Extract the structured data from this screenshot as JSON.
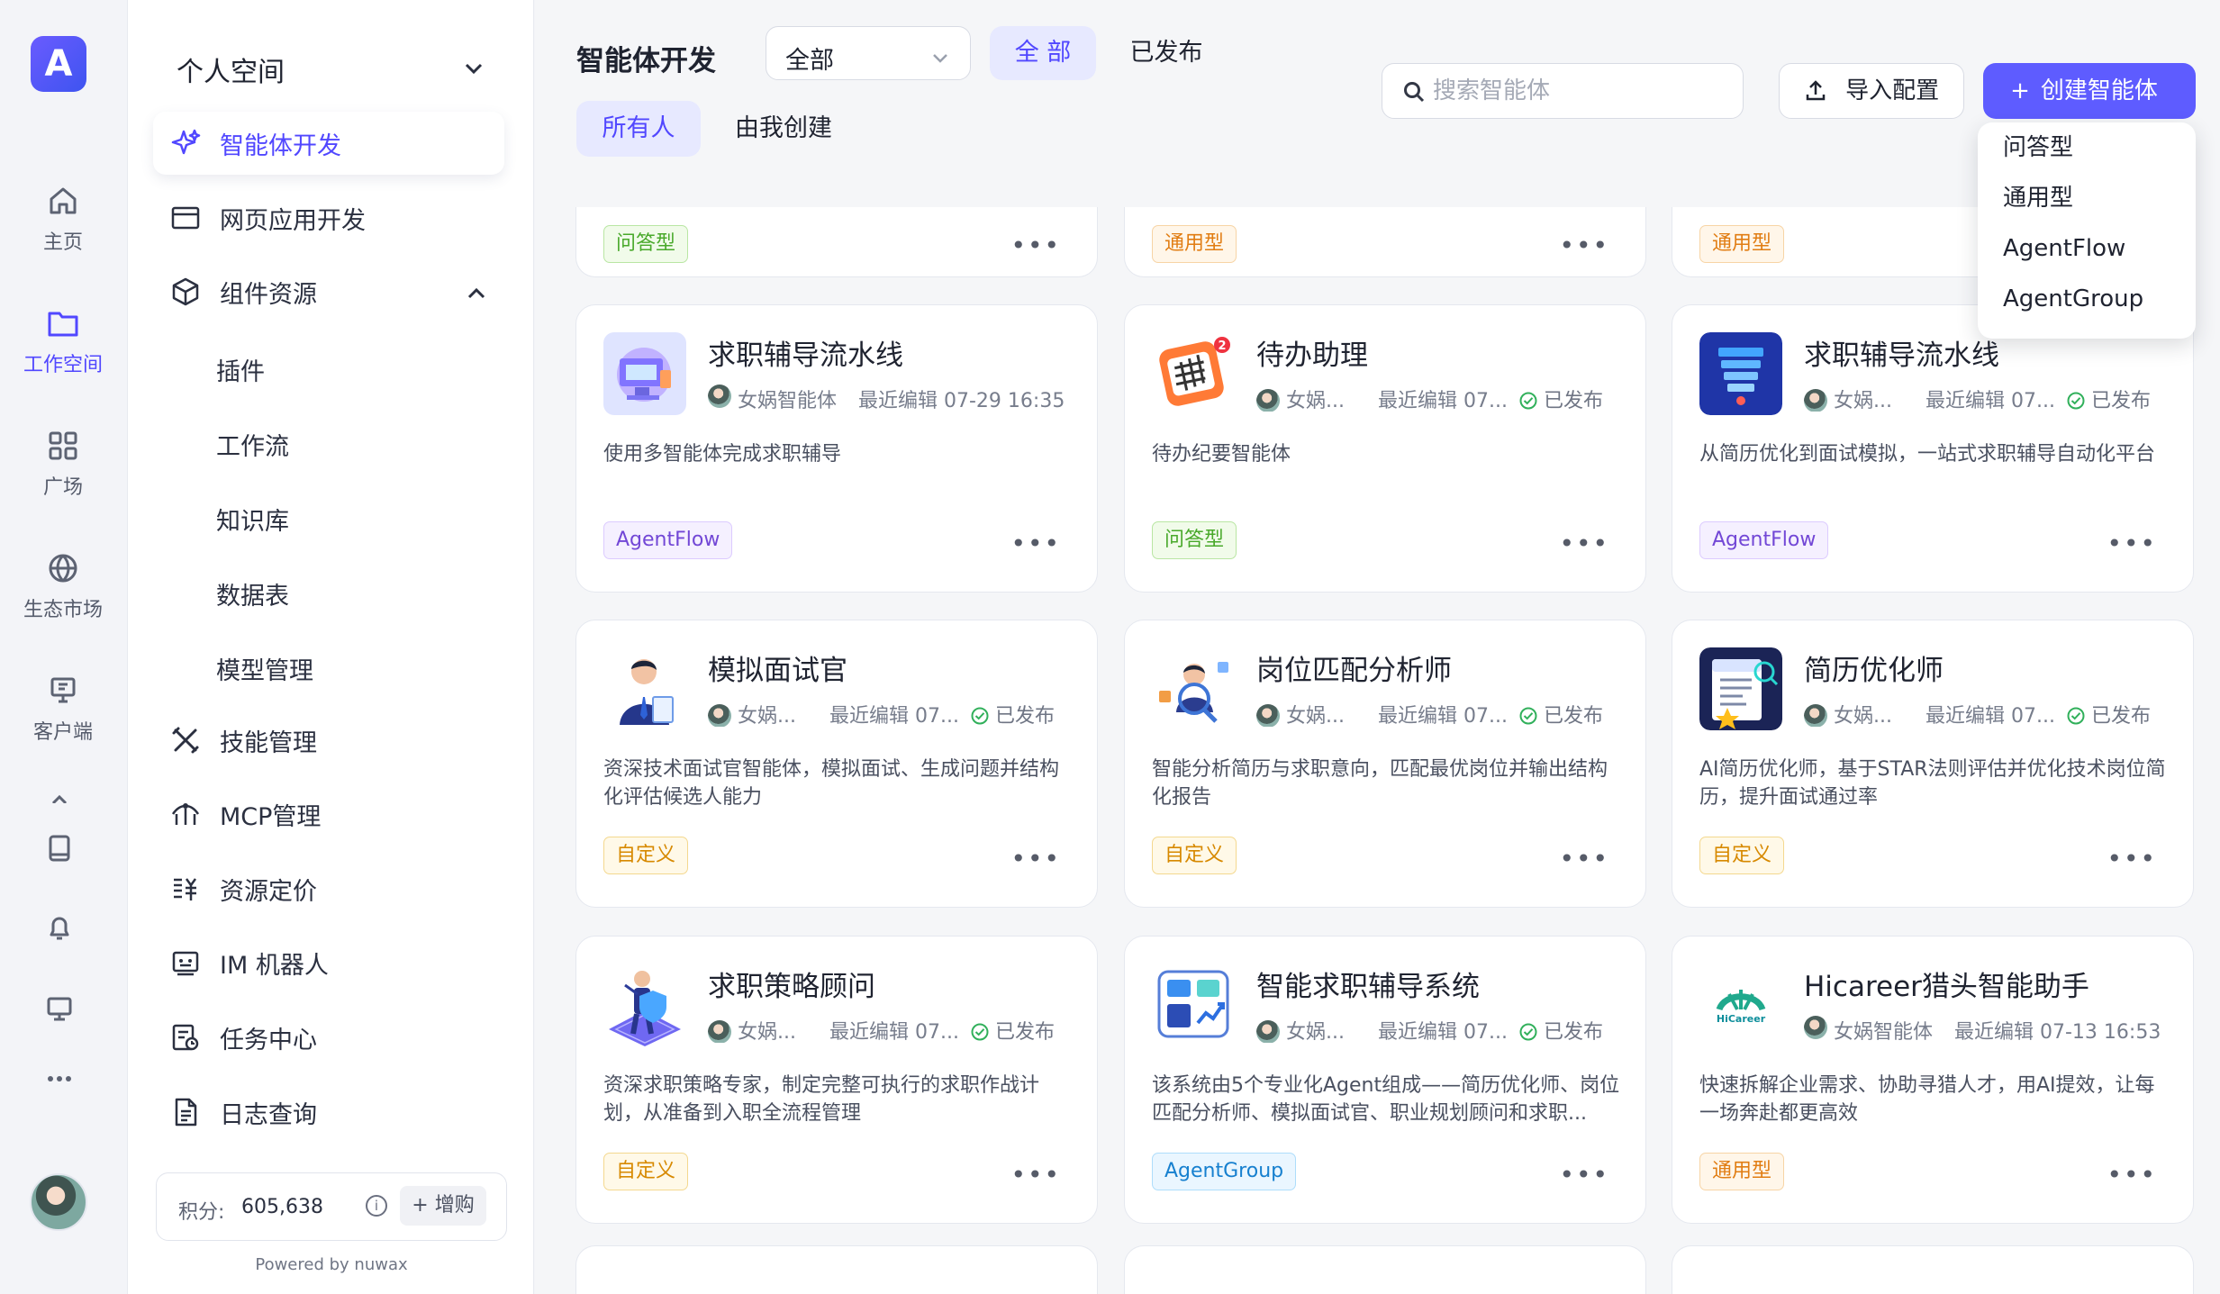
{
  "app": {
    "logo_text": "A"
  },
  "rail": [
    {
      "label": "主页",
      "icon": "home-icon"
    },
    {
      "label": "工作空间",
      "icon": "folder-icon"
    },
    {
      "label": "广场",
      "icon": "grid-icon"
    },
    {
      "label": "生态市场",
      "icon": "globe-icon"
    },
    {
      "label": "客户端",
      "icon": "desktop-client-icon"
    }
  ],
  "sidebar": {
    "space": "个人空间",
    "items": [
      {
        "label": "智能体开发",
        "icon": "sparkle-icon"
      },
      {
        "label": "网页应用开发",
        "icon": "browser-icon"
      },
      {
        "label": "组件资源",
        "icon": "cube-icon"
      },
      {
        "label": "插件"
      },
      {
        "label": "工作流"
      },
      {
        "label": "知识库"
      },
      {
        "label": "数据表"
      },
      {
        "label": "模型管理"
      },
      {
        "label": "技能管理",
        "icon": "tools-icon"
      },
      {
        "label": "MCP管理",
        "icon": "mcp-icon"
      },
      {
        "label": "资源定价",
        "icon": "pricing-icon"
      },
      {
        "label": "IM 机器人",
        "icon": "robot-icon"
      },
      {
        "label": "任务中心",
        "icon": "task-icon"
      },
      {
        "label": "日志查询",
        "icon": "log-icon"
      }
    ],
    "points_label": "积分:",
    "points_value": "605,638",
    "buy_label": "+ 增购",
    "powered_by": "Powered by nuwax"
  },
  "header": {
    "title": "智能体开发",
    "filter_value": "全部",
    "segments": [
      "全 部",
      "已发布"
    ],
    "owners": [
      "所有人",
      "由我创建"
    ],
    "search_placeholder": "搜索智能体",
    "import_label": "导入配置",
    "create_label": "创建智能体",
    "create_menu": [
      "问答型",
      "通用型",
      "AgentFlow",
      "AgentGroup"
    ]
  },
  "top_partial_tags": [
    "问答型",
    "通用型",
    "通用型"
  ],
  "cards": [
    {
      "title": "求职辅导流水线",
      "author": "女娲智能体",
      "edited": "最近编辑 07-29 16:35",
      "published": "",
      "description": "使用多智能体完成求职辅导",
      "tag": "AgentFlow"
    },
    {
      "title": "待办助理",
      "author": "女娲...",
      "edited": "最近编辑 07...",
      "published": "已发布",
      "description": "待办纪要智能体",
      "tag": "问答型"
    },
    {
      "title": "求职辅导流水线",
      "author": "女娲...",
      "edited": "最近编辑 07...",
      "published": "已发布",
      "description": "从简历优化到面试模拟，一站式求职辅导自动化平台",
      "tag": "AgentFlow"
    },
    {
      "title": "模拟面试官",
      "author": "女娲...",
      "edited": "最近编辑 07...",
      "published": "已发布",
      "description": "资深技术面试官智能体，模拟面试、生成问题并结构化评估候选人能力",
      "tag": "自定义"
    },
    {
      "title": "岗位匹配分析师",
      "author": "女娲...",
      "edited": "最近编辑 07...",
      "published": "已发布",
      "description": "智能分析简历与求职意向，匹配最优岗位并输出结构化报告",
      "tag": "自定义"
    },
    {
      "title": "简历优化师",
      "author": "女娲...",
      "edited": "最近编辑 07...",
      "published": "已发布",
      "description": "AI简历优化师，基于STAR法则评估并优化技术岗位简历，提升面试通过率",
      "tag": "自定义"
    },
    {
      "title": "求职策略顾问",
      "author": "女娲...",
      "edited": "最近编辑 07...",
      "published": "已发布",
      "description": "资深求职策略专家，制定完整可执行的求职作战计划，从准备到入职全流程管理",
      "tag": "自定义"
    },
    {
      "title": "智能求职辅导系统",
      "author": "女娲...",
      "edited": "最近编辑 07...",
      "published": "已发布",
      "description": "该系统由5个专业化Agent组成——简历优化师、岗位匹配分析师、模拟面试官、职业规划顾问和求职...",
      "tag": "AgentGroup"
    },
    {
      "title": "Hicareer猎头智能助手",
      "author": "女娲智能体",
      "edited": "最近编辑 07-13 16:53",
      "published": "",
      "description": "快速拆解企业需求、协助寻猎人才，用AI提效，让每一场奔赴都更高效",
      "tag": "通用型",
      "logo_text": "HiCareer"
    }
  ],
  "colors": {
    "accent": "#5e5cff",
    "active_text": "#5147ff",
    "published_check": "#31b05b"
  }
}
